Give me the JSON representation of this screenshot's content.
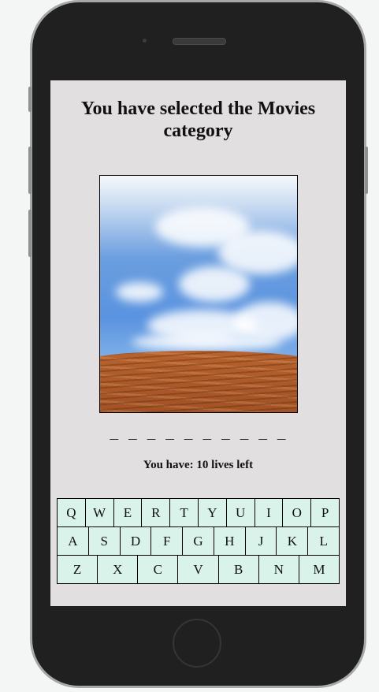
{
  "game": {
    "title": "You have selected the Movies category",
    "word_display": "_ _ _ _ _ _ _ _ _ _",
    "lives_text": "You have: 10 lives left"
  },
  "keyboard": {
    "rows": [
      [
        "Q",
        "W",
        "E",
        "R",
        "T",
        "Y",
        "U",
        "I",
        "O",
        "P"
      ],
      [
        "A",
        "S",
        "D",
        "F",
        "G",
        "H",
        "J",
        "K",
        "L"
      ],
      [
        "Z",
        "X",
        "C",
        "V",
        "B",
        "N",
        "M"
      ]
    ]
  },
  "colors": {
    "screen_bg": "#e1dfe0",
    "key_bg": "#d9f3ea",
    "phone_body": "#202020"
  }
}
